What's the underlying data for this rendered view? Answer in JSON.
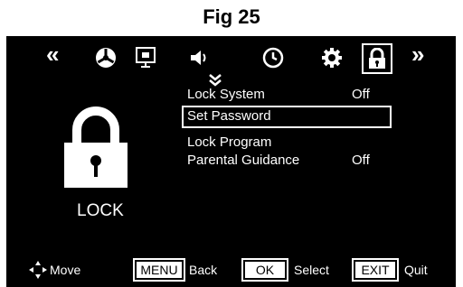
{
  "figure": {
    "title": "Fig 25"
  },
  "tv_menu": {
    "nav": {
      "prev": "«",
      "next": "»"
    },
    "top_icons": [
      {
        "name": "picture-icon"
      },
      {
        "name": "source-icon"
      },
      {
        "name": "sound-icon"
      },
      {
        "name": "time-icon"
      },
      {
        "name": "setup-icon"
      },
      {
        "name": "lock-icon"
      }
    ],
    "selected_tab": "lock-icon",
    "scroll_hint": "⌄",
    "section_label": "LOCK",
    "menu_items": [
      {
        "label": "Lock System",
        "value": "Off"
      },
      {
        "label": "Set Password",
        "value": ""
      },
      {
        "label": "Lock Program",
        "value": ""
      },
      {
        "label": "Parental Guidance",
        "value": "Off"
      }
    ],
    "selected_item_index": 1,
    "footer": {
      "move_label": "Move",
      "menu_key": "MENU",
      "back_label": "Back",
      "ok_key": "OK",
      "select_label": "Select",
      "exit_key": "EXIT",
      "quit_label": "Quit"
    }
  },
  "colors": {
    "background": "#000000",
    "foreground": "#ffffff"
  }
}
